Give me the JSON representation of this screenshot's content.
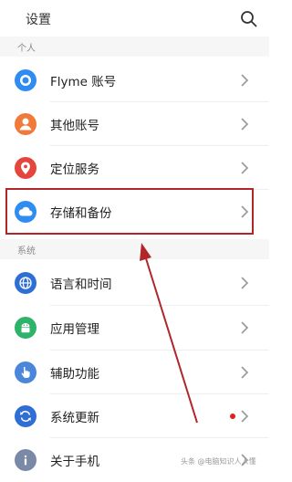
{
  "header": {
    "title": "设置",
    "search_icon": "search-icon"
  },
  "sections": [
    {
      "label": "个人"
    },
    {
      "label": "系统"
    }
  ],
  "items": [
    {
      "label": "Flyme 账号",
      "icon": "flyme-account-icon",
      "color": "#2f8cf0"
    },
    {
      "label": "其他账号",
      "icon": "user-icon",
      "color": "#f07a3a"
    },
    {
      "label": "定位服务",
      "icon": "location-pin-icon",
      "color": "#e5453d"
    },
    {
      "label": "存储和备份",
      "icon": "cloud-icon",
      "color": "#2f8cf0"
    },
    {
      "label": "语言和时间",
      "icon": "globe-icon",
      "color": "#2f6fd4"
    },
    {
      "label": "应用管理",
      "icon": "android-icon",
      "color": "#2fb36b"
    },
    {
      "label": "辅助功能",
      "icon": "hand-pointer-icon",
      "color": "#4a86d9"
    },
    {
      "label": "系统更新",
      "icon": "refresh-icon",
      "color": "#2f6fd4",
      "badge_color": "#e02020"
    },
    {
      "label": "关于手机",
      "icon": "info-icon",
      "color": "#7a8aa6"
    }
  ],
  "annotation": {
    "highlight_color": "#b0262a",
    "highlighted_item": "存储和备份"
  },
  "watermark": "头条 @电脑知识人人懂"
}
